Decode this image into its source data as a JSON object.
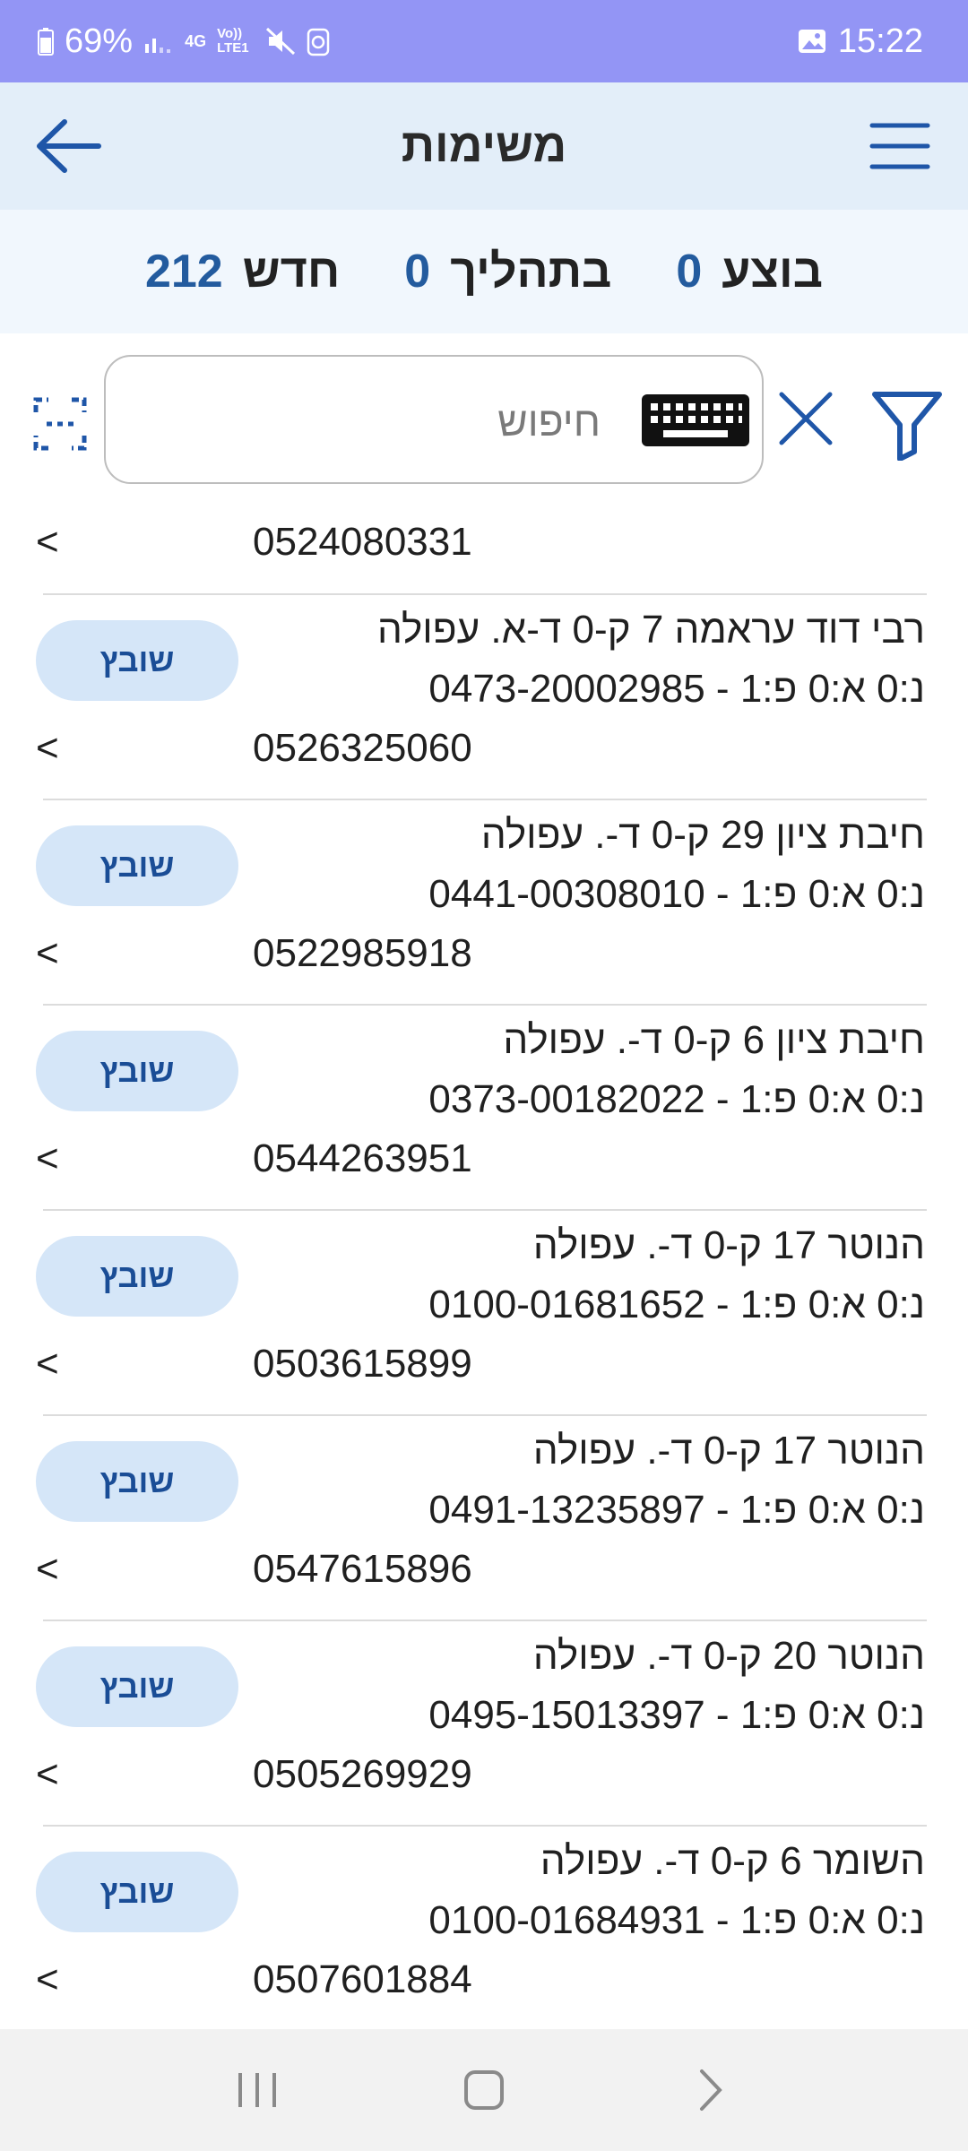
{
  "status_bar": {
    "battery": "69%",
    "network": "4G",
    "volte": "Vo)) LTE1",
    "time": "15:22"
  },
  "header": {
    "title": "משימות"
  },
  "summary": [
    {
      "label": "בוצע",
      "value": "0"
    },
    {
      "label": "בתהליך",
      "value": "0"
    },
    {
      "label": "חדש",
      "value": "212"
    }
  ],
  "search": {
    "placeholder": "חיפוש",
    "value": ""
  },
  "first_item": {
    "phone": "0524080331",
    "chevron": "<"
  },
  "tasks": [
    {
      "address": "רבי דוד עראמה 7 ק-0 ד-א. עפולה",
      "reference": "נ:0 א:0 פ:1 - 0473-20002985",
      "phone": "0526325060",
      "status": "שובץ",
      "chevron": "<"
    },
    {
      "address": "חיבת ציון 29 ק-0 ד-. עפולה",
      "reference": "נ:0 א:0 פ:1 - 0441-00308010",
      "phone": "0522985918",
      "status": "שובץ",
      "chevron": "<"
    },
    {
      "address": "חיבת ציון 6 ק-0 ד-. עפולה",
      "reference": "נ:0 א:0 פ:1 - 0373-00182022",
      "phone": "0544263951",
      "status": "שובץ",
      "chevron": "<"
    },
    {
      "address": "הנוטר 17 ק-0 ד-. עפולה",
      "reference": "נ:0 א:0 פ:1 - 0100-01681652",
      "phone": "0503615899",
      "status": "שובץ",
      "chevron": "<"
    },
    {
      "address": "הנוטר 17 ק-0 ד-. עפולה",
      "reference": "נ:0 א:0 פ:1 - 0491-13235897",
      "phone": "0547615896",
      "status": "שובץ",
      "chevron": "<"
    },
    {
      "address": "הנוטר 20 ק-0 ד-. עפולה",
      "reference": "נ:0 א:0 פ:1 - 0495-15013397",
      "phone": "0505269929",
      "status": "שובץ",
      "chevron": "<"
    },
    {
      "address": "השומר 6 ק-0 ד-. עפולה",
      "reference": "נ:0 א:0 פ:1 - 0100-01684931",
      "phone": "0507601884",
      "status": "שובץ",
      "chevron": "<"
    }
  ],
  "colors": {
    "status_bar": "#9395f5",
    "app_bar": "#e3eef9",
    "accent": "#235b9e",
    "pill_bg": "#d5e6f8",
    "pill_text": "#1a4d96"
  },
  "icons": {
    "back": "arrow-left-icon",
    "menu": "hamburger-menu-icon",
    "scan": "scan-frame-icon",
    "keyboard": "keyboard-icon",
    "clear": "close-icon",
    "filter": "filter-funnel-icon"
  }
}
